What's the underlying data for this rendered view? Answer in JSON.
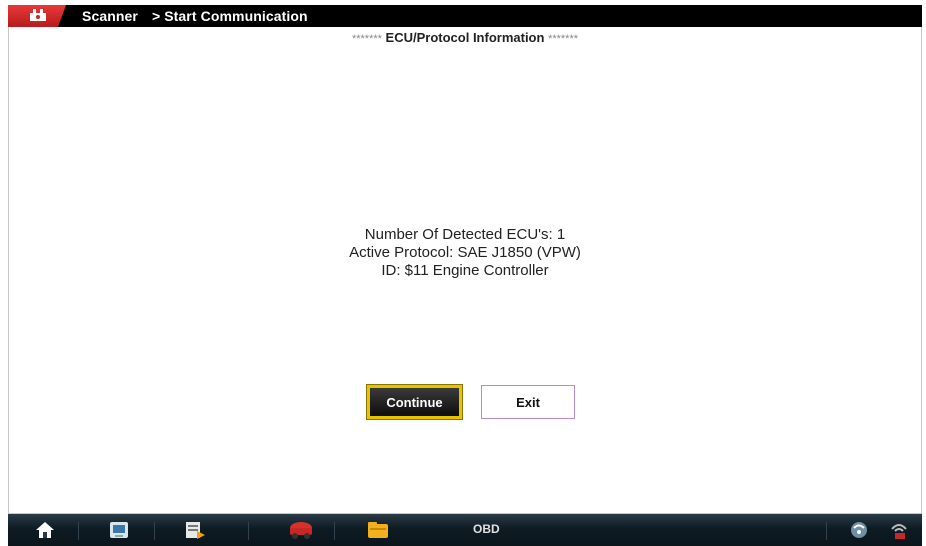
{
  "titlebar": {
    "app_name": "Scanner",
    "breadcrumb": "> Start Communication"
  },
  "header": {
    "stars_left": "*******",
    "title": "ECU/Protocol Information",
    "stars_right": "*******"
  },
  "info": {
    "line1": "Number Of Detected ECU's: 1",
    "line2": "Active Protocol: SAE J1850 (VPW)",
    "line3": "ID: $11 Engine Controller"
  },
  "buttons": {
    "continue_label": "Continue",
    "exit_label": "Exit"
  },
  "bottombar": {
    "label": "OBD",
    "icons": [
      "home-icon",
      "scanner-icon",
      "data-icon",
      "car-icon",
      "folder-icon",
      "vehicle-comm-icon",
      "wireless-icon"
    ]
  },
  "colors": {
    "titlebar_bg": "#000000",
    "logo_red": "#d32f2f",
    "continue_border": "#e6c200",
    "exit_border": "#b68bd6",
    "bottombar_bg": "#0e1b23"
  }
}
